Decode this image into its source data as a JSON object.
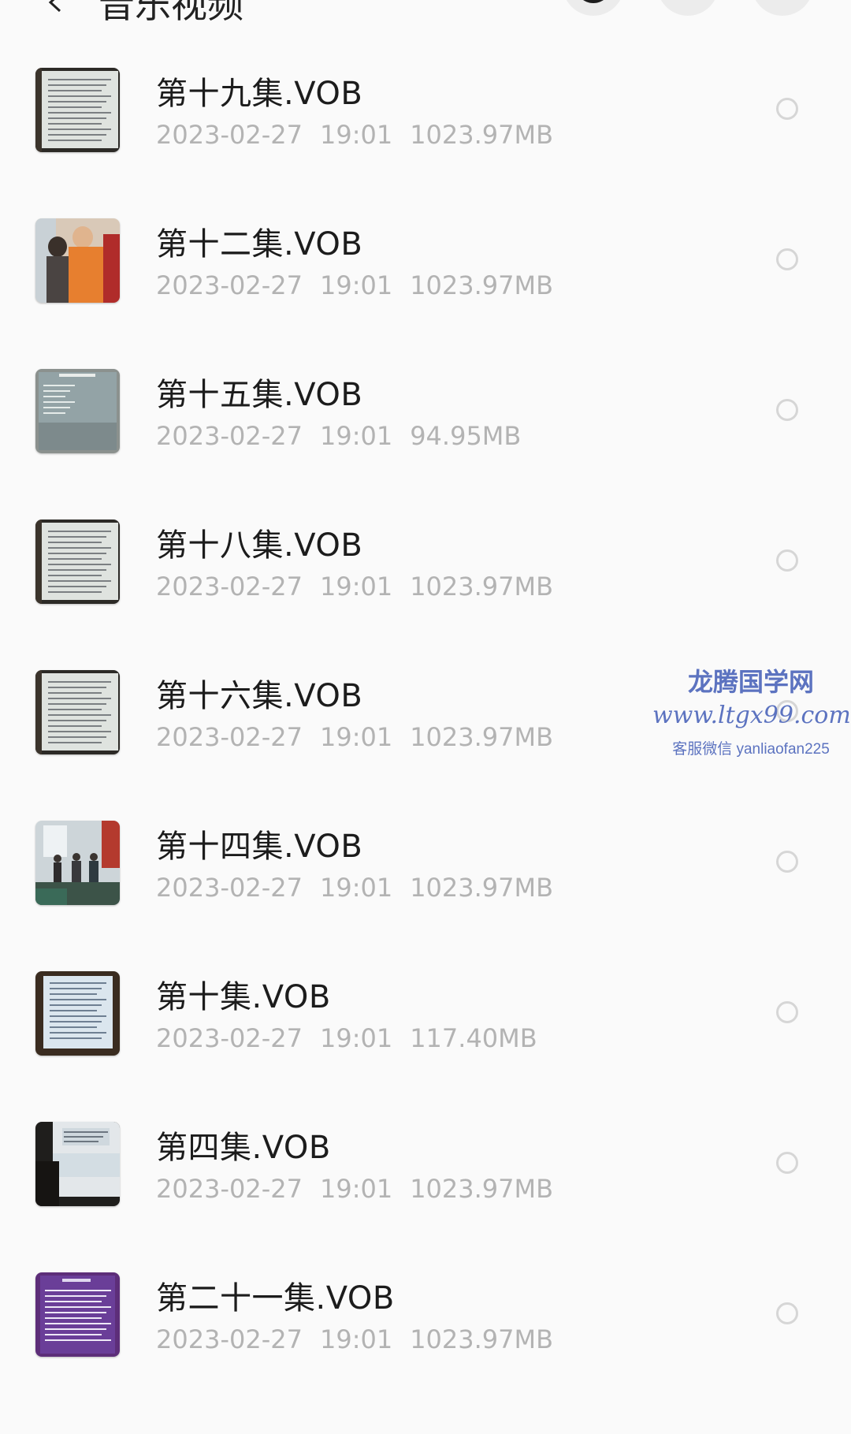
{
  "header": {
    "title": "音乐视频"
  },
  "files": [
    {
      "name": "第十九集.VOB",
      "date": "2023-02-27",
      "time": "19:01",
      "size": "1023.97MB",
      "thumb": "slide"
    },
    {
      "name": "第十二集.VOB",
      "date": "2023-02-27",
      "time": "19:01",
      "size": "1023.97MB",
      "thumb": "people"
    },
    {
      "name": "第十五集.VOB",
      "date": "2023-02-27",
      "time": "19:01",
      "size": "94.95MB",
      "thumb": "slide-gray"
    },
    {
      "name": "第十八集.VOB",
      "date": "2023-02-27",
      "time": "19:01",
      "size": "1023.97MB",
      "thumb": "slide"
    },
    {
      "name": "第十六集.VOB",
      "date": "2023-02-27",
      "time": "19:01",
      "size": "1023.97MB",
      "thumb": "slide"
    },
    {
      "name": "第十四集.VOB",
      "date": "2023-02-27",
      "time": "19:01",
      "size": "1023.97MB",
      "thumb": "room"
    },
    {
      "name": "第十集.VOB",
      "date": "2023-02-27",
      "time": "19:01",
      "size": "117.40MB",
      "thumb": "slide-blue"
    },
    {
      "name": "第四集.VOB",
      "date": "2023-02-27",
      "time": "19:01",
      "size": "1023.97MB",
      "thumb": "slide-dark"
    },
    {
      "name": "第二十一集.VOB",
      "date": "2023-02-27",
      "time": "19:01",
      "size": "1023.97MB",
      "thumb": "slide-purple"
    }
  ],
  "watermark": {
    "line1": "龙腾国学网",
    "line2": "www.ltgx99.com",
    "line3": "客服微信 yanliaofan225"
  },
  "colors": {
    "background": "#fafafa",
    "name_text": "#1c1c1c",
    "meta_text": "#b3b3b3",
    "radio_border": "#d6d6d6",
    "watermark": "#5c73c0"
  }
}
